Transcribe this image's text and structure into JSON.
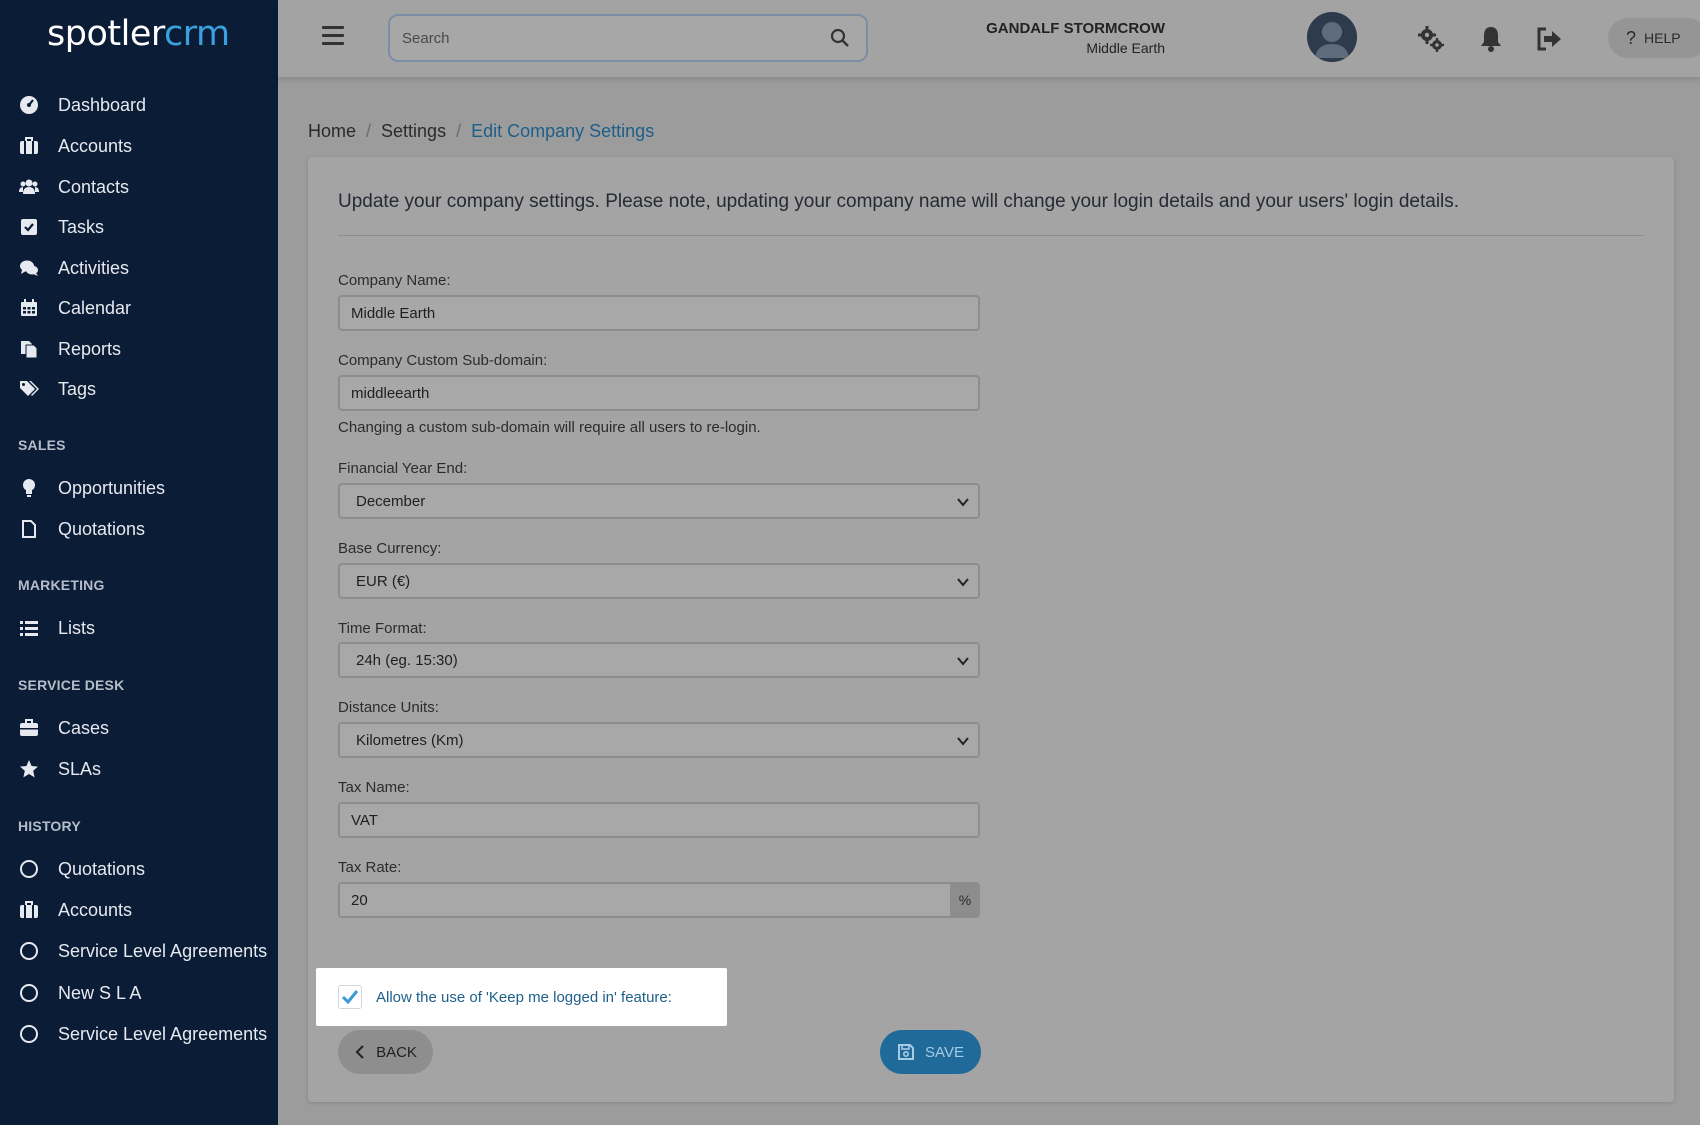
{
  "logo": {
    "part1": "spotler",
    "part2": "crm"
  },
  "sidebar": {
    "main_items": [
      {
        "label": "Dashboard",
        "icon": "dashboard-icon"
      },
      {
        "label": "Accounts",
        "icon": "briefcase-icon"
      },
      {
        "label": "Contacts",
        "icon": "users-icon"
      },
      {
        "label": "Tasks",
        "icon": "checkbox-icon"
      },
      {
        "label": "Activities",
        "icon": "comments-icon"
      },
      {
        "label": "Calendar",
        "icon": "calendar-icon"
      },
      {
        "label": "Reports",
        "icon": "copy-icon"
      },
      {
        "label": "Tags",
        "icon": "tags-icon"
      }
    ],
    "sales_title": "SALES",
    "sales_items": [
      {
        "label": "Opportunities",
        "icon": "lightbulb-icon"
      },
      {
        "label": "Quotations",
        "icon": "file-icon"
      }
    ],
    "marketing_title": "MARKETING",
    "marketing_items": [
      {
        "label": "Lists",
        "icon": "list-icon"
      }
    ],
    "service_title": "SERVICE DESK",
    "service_items": [
      {
        "label": "Cases",
        "icon": "toolbox-icon"
      },
      {
        "label": "SLAs",
        "icon": "star-icon"
      }
    ],
    "history_title": "HISTORY",
    "history_items": [
      {
        "label": "Quotations",
        "icon": "circle-icon"
      },
      {
        "label": "Accounts",
        "icon": "briefcase-icon"
      },
      {
        "label": "Service Level Agreements",
        "icon": "circle-icon"
      },
      {
        "label": "New S L A",
        "icon": "circle-icon"
      },
      {
        "label": "Service Level Agreements",
        "icon": "circle-icon"
      }
    ]
  },
  "header": {
    "search_placeholder": "Search",
    "user_name": "GANDALF STORMCROW",
    "user_org": "Middle Earth",
    "help_label": "HELP"
  },
  "breadcrumb": {
    "home": "Home",
    "settings": "Settings",
    "current": "Edit Company Settings"
  },
  "form": {
    "intro": "Update your company settings. Please note, updating your company name will change your login details and your users' login details.",
    "company_name": {
      "label": "Company Name:",
      "value": "Middle Earth"
    },
    "subdomain": {
      "label": "Company Custom Sub-domain:",
      "value": "middleearth",
      "help": "Changing a custom sub-domain will require all users to re-login."
    },
    "financial_year_end": {
      "label": "Financial Year End:",
      "value": "December"
    },
    "base_currency": {
      "label": "Base Currency:",
      "value": "EUR (€)"
    },
    "time_format": {
      "label": "Time Format:",
      "value": "24h (eg. 15:30)"
    },
    "distance_units": {
      "label": "Distance Units:",
      "value": "Kilometres (Km)"
    },
    "tax_name": {
      "label": "Tax Name:",
      "value": "VAT"
    },
    "tax_rate": {
      "label": "Tax Rate:",
      "value": "20",
      "unit": "%"
    },
    "keep_logged_in": {
      "label": "Allow the use of 'Keep me logged in' feature:",
      "checked": true
    },
    "back_label": "BACK",
    "save_label": "SAVE"
  },
  "colors": {
    "sidebar_bg": "#0b1c36",
    "accent": "#3aa0de",
    "save_button": "#1f6a99"
  }
}
